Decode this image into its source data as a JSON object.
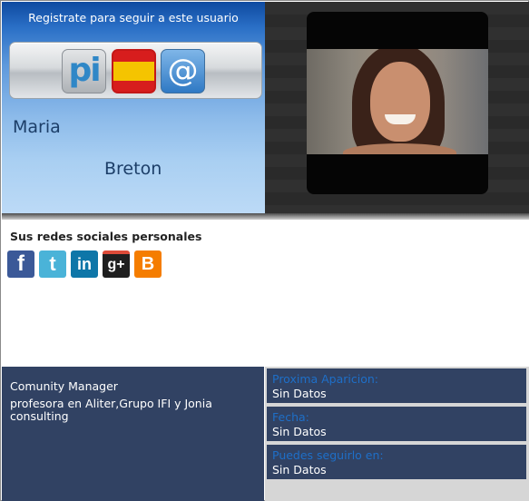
{
  "header": {
    "register_text": "Registrate para seguir a este usuario"
  },
  "icons": [
    {
      "name": "pi-icon",
      "glyph": "pi"
    },
    {
      "name": "spain-flag-icon",
      "colors": [
        "#d71d1d",
        "#f5c400"
      ]
    },
    {
      "name": "at-email-icon",
      "glyph": "@"
    }
  ],
  "profile": {
    "first_name": "Maria",
    "last_name": "Breton"
  },
  "social": {
    "title": "Sus redes sociales personales",
    "networks": [
      {
        "name": "facebook-icon",
        "glyph": "f"
      },
      {
        "name": "twitter-icon",
        "glyph": "t"
      },
      {
        "name": "linkedin-icon",
        "glyph": "in"
      },
      {
        "name": "google-plus-icon",
        "glyph": "g+"
      },
      {
        "name": "blogger-icon",
        "glyph": "B"
      }
    ]
  },
  "bio": {
    "job_title": "Comunity Manager",
    "work": "profesora en Aliter,Grupo IFI y Jonia consulting"
  },
  "info": [
    {
      "label": "Proxima Aparicion:",
      "value": "Sin Datos"
    },
    {
      "label": "Fecha:",
      "value": "Sin Datos"
    },
    {
      "label": "Puedes seguirlo en:",
      "value": "Sin Datos"
    }
  ],
  "colors": {
    "panel_dark_blue": "#314263",
    "label_blue": "#1e6fc8",
    "name_blue": "#1c3e68"
  }
}
